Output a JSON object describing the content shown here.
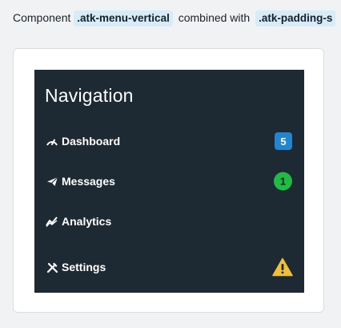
{
  "intro": {
    "prefix": "Component",
    "class_a": ".atk-menu-vertical",
    "middle": "combined with",
    "class_b": ".atk-padding-s"
  },
  "menu": {
    "title": "Navigation",
    "items": [
      {
        "label": "Dashboard",
        "icon": "speedometer-icon",
        "badge": "5",
        "badge_color": "#2185d0"
      },
      {
        "label": "Messages",
        "icon": "paper-plane-icon",
        "badge": "1",
        "badge_color": "#21ba45"
      },
      {
        "label": "Analytics",
        "icon": "line-chart-icon"
      },
      {
        "label": "Settings",
        "icon": "tools-icon",
        "alert_icon": "warning-icon",
        "alert_color": "#f2c037"
      }
    ]
  }
}
